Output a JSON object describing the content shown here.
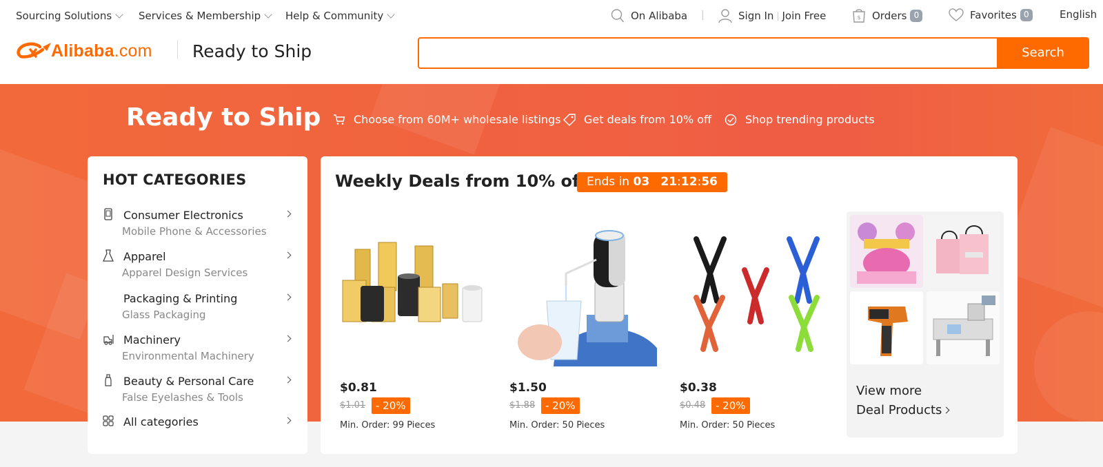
{
  "top_nav": {
    "left": [
      {
        "label": "Sourcing Solutions"
      },
      {
        "label": "Services & Membership"
      },
      {
        "label": "Help & Community"
      }
    ],
    "on_alibaba": "On Alibaba",
    "sign_in": "Sign In",
    "join_free": "Join Free",
    "orders": {
      "label": "Orders",
      "count": "0"
    },
    "favorites": {
      "label": "Favorites",
      "count": "0"
    },
    "language": "English"
  },
  "header": {
    "logo": {
      "brand": "Alibaba",
      "suffix": ".com"
    },
    "title": "Ready to Ship",
    "search": {
      "value": "",
      "placeholder": "",
      "button": "Search"
    }
  },
  "hero": {
    "title": "Ready to Ship",
    "features": [
      {
        "icon": "cart-icon",
        "text": "Choose from 60M+ wholesale listings"
      },
      {
        "icon": "tag-icon",
        "text": "Get deals from 10% off"
      },
      {
        "icon": "check-circle-icon",
        "text": "Shop trending products"
      }
    ]
  },
  "categories": {
    "heading": "HOT CATEGORIES",
    "items": [
      {
        "name": "Consumer Electronics",
        "sub": "Mobile Phone & Accessories",
        "icon": "phone-icon"
      },
      {
        "name": "Apparel",
        "sub": "Apparel Design Services",
        "icon": "dress-icon"
      },
      {
        "name": "Packaging & Printing",
        "sub": "Glass Packaging",
        "icon": ""
      },
      {
        "name": "Machinery",
        "sub": "Environmental Machinery",
        "icon": "forklift-icon"
      },
      {
        "name": "Beauty & Personal Care",
        "sub": "False Eyelashes & Tools",
        "icon": "bottle-icon"
      }
    ],
    "all": {
      "name": "All categories",
      "icon": "grid-icon"
    }
  },
  "deals": {
    "title": "Weekly Deals from 10% off",
    "countdown": {
      "prefix": "Ends in",
      "days": "03",
      "hours": "21",
      "minutes": "12",
      "seconds": "56"
    },
    "products": [
      {
        "price": "$0.81",
        "old_price": "$1.01",
        "discount": "- 20%",
        "moq": "Min. Order: 99 Pieces",
        "image": "oil-filters"
      },
      {
        "price": "$1.50",
        "old_price": "$1.88",
        "discount": "- 20%",
        "moq": "Min. Order: 50 Pieces",
        "image": "water-dispenser-pump"
      },
      {
        "price": "$0.38",
        "old_price": "$0.48",
        "discount": "- 20%",
        "moq": "Min. Order: 50 Pieces",
        "image": "reflective-vests"
      }
    ],
    "view_more": {
      "line1": "View more",
      "line2": "Deal Products"
    }
  },
  "colors": {
    "brand": "#ff6a00",
    "hero": "#f0623f"
  }
}
